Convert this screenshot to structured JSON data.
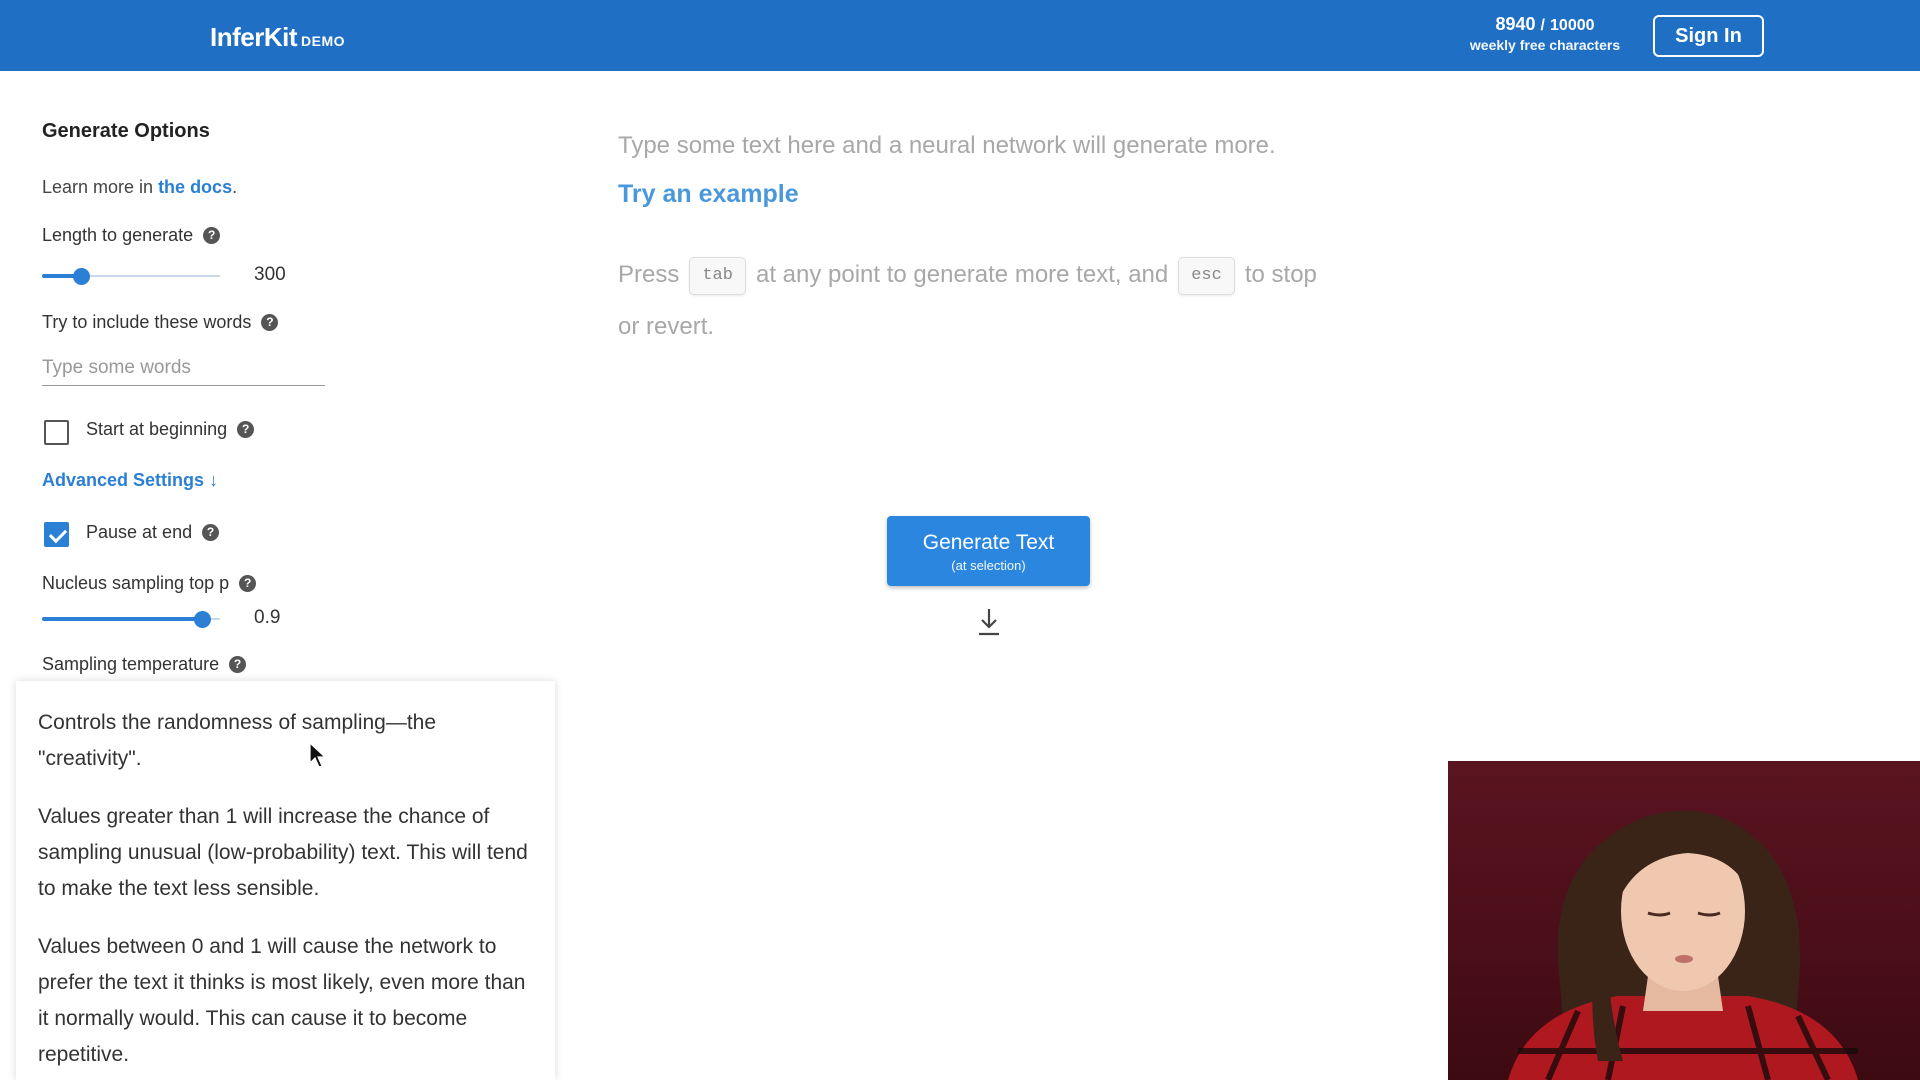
{
  "header": {
    "brand": "InferKit",
    "brand_tag": "DEMO",
    "quota_used": "8940",
    "quota_sep": "/",
    "quota_max": "10000",
    "quota_label": "weekly free characters",
    "signin_label": "Sign In"
  },
  "sidebar": {
    "title": "Generate Options",
    "learn_prefix": "Learn more in ",
    "learn_link": "the docs",
    "learn_suffix": ".",
    "length": {
      "label": "Length to generate",
      "value": "300",
      "fraction": 0.22
    },
    "include_words": {
      "label": "Try to include these words",
      "placeholder": "Type some words",
      "value": ""
    },
    "start_at_beginning": {
      "label": "Start at beginning",
      "checked": false
    },
    "advanced_label": "Advanced Settings",
    "advanced_arrow": "↓",
    "pause_at_end": {
      "label": "Pause at end",
      "checked": true
    },
    "nucleus": {
      "label": "Nucleus sampling top p",
      "value": "0.9",
      "fraction": 0.9
    },
    "temperature": {
      "label": "Sampling temperature"
    },
    "help_glyph": "?"
  },
  "tooltip": {
    "p1": "Controls the randomness of sampling—the \"creativity\".",
    "p2": "Values greater than 1 will increase the chance of sampling unusual (low-probability) text. This will tend to make the text less sensible.",
    "p3": "Values between 0 and 1 will cause the network to prefer the text it thinks is most likely, even more than it normally would. This can cause it to become repetitive."
  },
  "editor": {
    "placeholder": "Type some text here and a neural network will generate more.",
    "example_link": "Try an example",
    "hint_press": "Press",
    "hint_key1": "tab",
    "hint_mid": "at any point to generate more text, and",
    "hint_key2": "esc",
    "hint_end": "to stop or revert."
  },
  "generate": {
    "label": "Generate Text",
    "sublabel": "(at selection)"
  },
  "colors": {
    "header_bg": "#1f6fc5",
    "accent": "#2b7fd4",
    "button": "#2b86e0"
  }
}
